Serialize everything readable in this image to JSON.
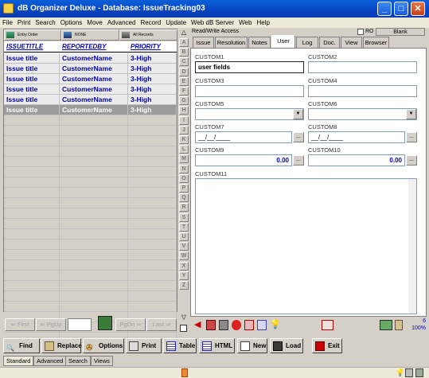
{
  "window": {
    "title": "dB Organizer Deluxe - Database: IssueTracking03",
    "buttons": [
      "_",
      "□",
      "✕"
    ]
  },
  "menu": [
    "File",
    "Print",
    "Search",
    "Options",
    "Move",
    "Advanced",
    "Record",
    "Update",
    "Web dB Server",
    "Web",
    "Help"
  ],
  "sort_toolbar": {
    "entry_order": "Entry Order",
    "filter": "NONE",
    "records": "All Records"
  },
  "grid": {
    "headers": [
      "ISSUETITLE",
      "REPORTEDBY",
      "PRIORITY"
    ],
    "rows": [
      [
        "Issue title",
        "CustomerName",
        "3-High"
      ],
      [
        "Issue title",
        "CustomerName",
        "3-High"
      ],
      [
        "Issue title",
        "CustomerName",
        "3-High"
      ],
      [
        "Issue title",
        "CustomerName",
        "3-High"
      ],
      [
        "Issue title",
        "CustomerName",
        "3-High"
      ],
      [
        "Issue title",
        "CustomerName",
        "3-High"
      ]
    ],
    "selected_row": 5
  },
  "nav": {
    "first": "First",
    "pgup": "PgUp",
    "pgdn": "PgDn",
    "last": "Last"
  },
  "alpha": [
    "A",
    "B",
    "C",
    "D",
    "E",
    "F",
    "G",
    "H",
    "I",
    "J",
    "K",
    "L",
    "M",
    "N",
    "O",
    "P",
    "Q",
    "R",
    "S",
    "T",
    "U",
    "V",
    "W",
    "X",
    "Y",
    "Z"
  ],
  "panel": {
    "access": "Read/Write Access",
    "ro": "RO",
    "blank": "Blank",
    "tabs": [
      "Issue",
      "Resolution",
      "Notes",
      "User",
      "Log",
      "Doc.",
      "View",
      "Browser"
    ],
    "active_tab": "User"
  },
  "fields": {
    "custom1": {
      "label": "CUSTOM1",
      "value": "user fields"
    },
    "custom2": {
      "label": "CUSTOM2",
      "value": ""
    },
    "custom3": {
      "label": "CUSTOM3",
      "value": ""
    },
    "custom4": {
      "label": "CUSTOM4",
      "value": ""
    },
    "custom5": {
      "label": "CUSTOM5",
      "value": ""
    },
    "custom6": {
      "label": "CUSTOM6",
      "value": ""
    },
    "custom7": {
      "label": "CUSTOM7",
      "value": "__/__/____"
    },
    "custom8": {
      "label": "CUSTOM8",
      "value": "__/__/____"
    },
    "custom9": {
      "label": "CUSTOM9",
      "value": "0.00"
    },
    "custom10": {
      "label": "CUSTOM10",
      "value": "0.00"
    },
    "custom11": {
      "label": "CUSTOM11",
      "value": ""
    }
  },
  "record_info": {
    "count": "6",
    "zoom": "100%"
  },
  "bottom_buttons": [
    "Find",
    "Replace",
    "Options",
    "Print",
    "Table",
    "HTML",
    "New",
    "Load",
    "Exit"
  ],
  "bottom_tabs": [
    "Standard",
    "Advanced",
    "Search",
    "Views"
  ],
  "colors": {
    "title_bar": "#0a5fd8",
    "grid_text": "#0000a8",
    "selected_row": "#9c9c9c",
    "number_value": "#0000c8"
  }
}
